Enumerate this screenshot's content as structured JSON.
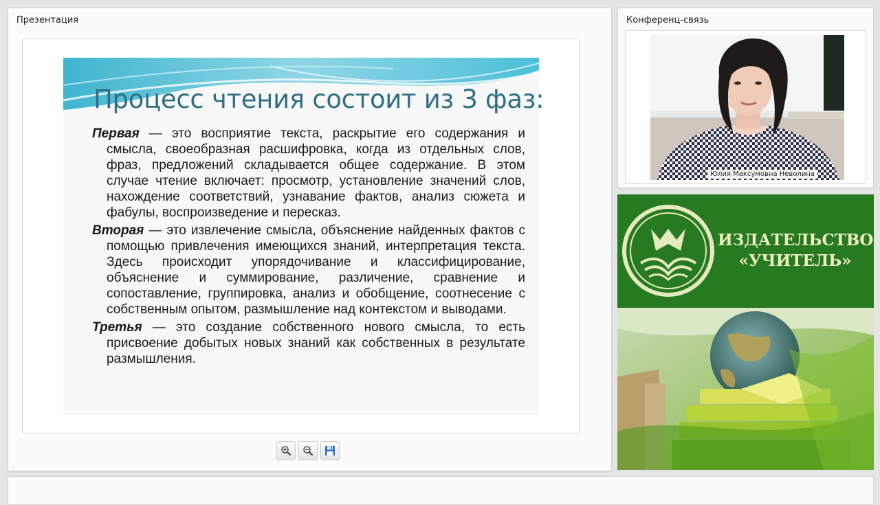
{
  "presentation": {
    "title": "Презентация",
    "slide": {
      "title": "Процесс чтения состоит из 3 фаз:",
      "paragraphs": [
        {
          "lead": "Первая",
          "text": " — это восприятие текста, раскрытие его содержания и смысла, своеобразная расшифровка, когда из отдельных слов, фраз, предложений складывается общее содержание. В этом случае чтение включает: просмотр, установление значений слов, нахождение соответствий, узнавание фактов, анализ сюжета и фабулы, воспроизведение и пересказ."
        },
        {
          "lead": "Вторая",
          "text": " — это извлечение смысла, объяснение найденных фактов с помощью привлечения имеющихся знаний, интерпретация текста. Здесь происходит упорядочивание и классифицирование, объяснение и суммирование, различение, сравнение и сопоставление, группировка, анализ и обобщение, соотнесение с собственным опытом, размышление над контекстом и выводами."
        },
        {
          "lead": "Третья",
          "text": " — это создание собственного нового смысла, то есть присвоение добытых новых знаний как собственных в результате размышления."
        }
      ]
    },
    "toolbar": {
      "zoom_in_icon": "zoom-in-icon",
      "zoom_out_icon": "zoom-out-icon",
      "save_icon": "save-icon"
    }
  },
  "conference": {
    "title": "Конференц-связь",
    "participant_name": "Юлия Максумовна Неволина"
  },
  "publisher": {
    "name_line1": "ИЗДАТЕЛЬСТВО",
    "name_line2": "«УЧИТЕЛЬ»",
    "brand_color": "#277a1f"
  }
}
